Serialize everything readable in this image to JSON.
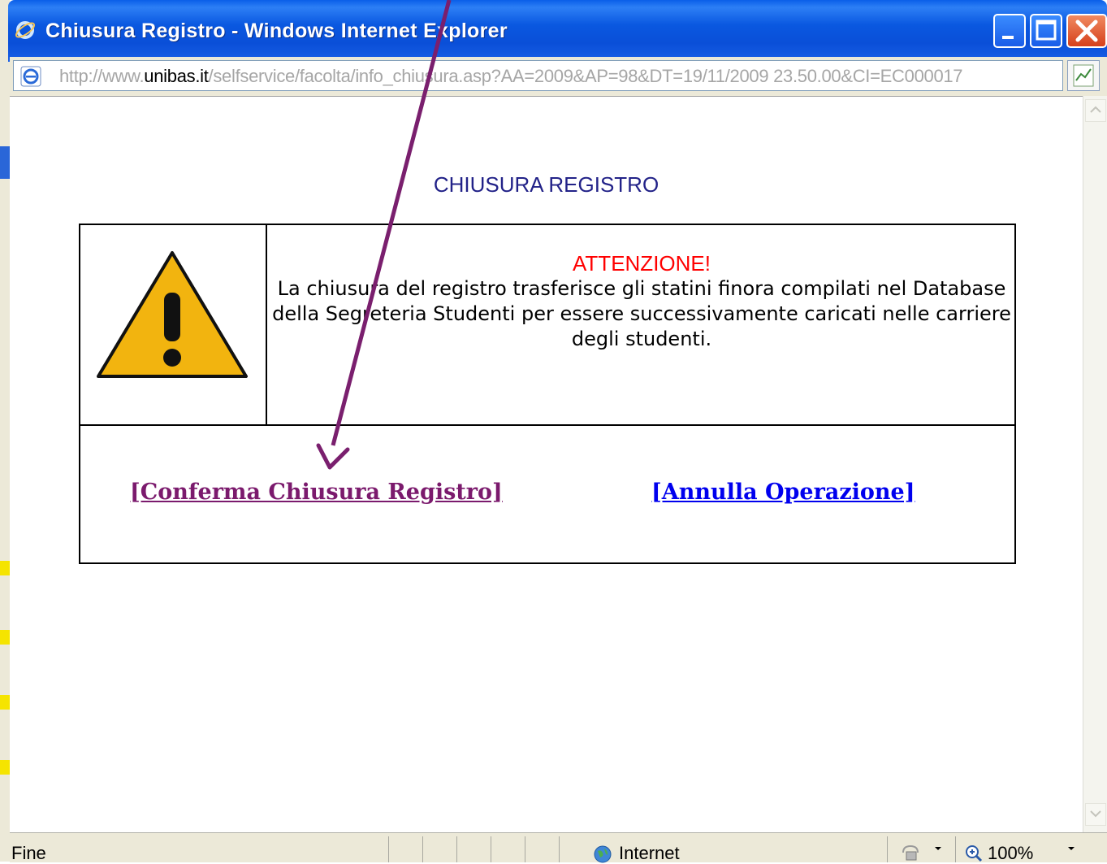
{
  "window": {
    "title": "Chiusura Registro - Windows Internet Explorer"
  },
  "address_bar": {
    "url_prefix": "http://www.",
    "url_host": "unibas.it",
    "url_rest": "/selfservice/facolta/info_chiusura.asp?AA=2009&AP=98&DT=19/11/2009 23.50.00&CI=EC000017"
  },
  "content": {
    "heading": "CHIUSURA REGISTRO",
    "notice_title": "ATTENZIONE!",
    "notice_body": "La chiusura del registro trasferisce gli statini finora compilati nel Database della Segreteria Studenti per essere successivamente caricati nelle carriere degli studenti.",
    "confirm_link": "[Conferma Chiusura Registro]",
    "cancel_link": "[Annulla Operazione]"
  },
  "status_bar": {
    "status": "Fine",
    "zone": "Internet",
    "zoom": "100%"
  },
  "colors": {
    "titlebar": "#0a58e0",
    "heading": "#222288",
    "notice_title": "#ff0000",
    "confirm_link": "#7b1a6d",
    "cancel_link": "#0000ee",
    "annotation_arrow": "#7a1f6e",
    "warning_fill": "#f2b40f"
  },
  "icons": [
    "ie-logo-icon",
    "page-icon",
    "rss-feed-icon",
    "minimize-icon",
    "maximize-icon",
    "close-icon",
    "warning-icon",
    "globe-icon",
    "protected-mode-icon",
    "zoom-icon"
  ]
}
